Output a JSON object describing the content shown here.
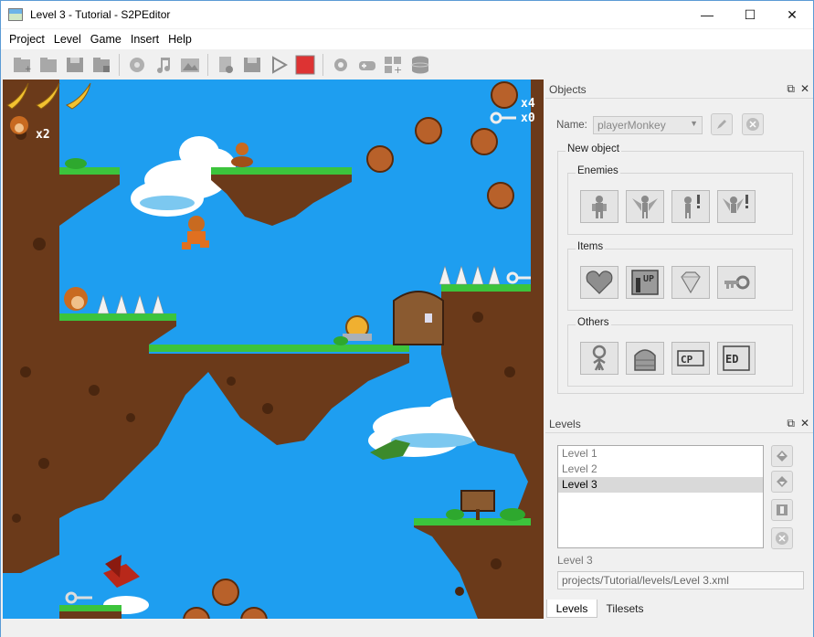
{
  "window": {
    "title": "Level 3 - Tutorial - S2PEditor",
    "minimize_glyph": "—",
    "maximize_glyph": "☐",
    "close_glyph": "✕"
  },
  "menu": {
    "items": [
      "Project",
      "Level",
      "Game",
      "Insert",
      "Help"
    ]
  },
  "toolbar": {
    "icons": [
      "new-project-icon",
      "open-project-icon",
      "save-project-icon",
      "export-project-icon",
      "tileset-icon",
      "music-icon",
      "image-icon",
      "new-level-icon",
      "save-level-icon",
      "play-icon",
      "stop-icon",
      "settings-icon",
      "gamepad-icon",
      "add-tiles-icon",
      "database-icon"
    ]
  },
  "game": {
    "lives": "x2",
    "coins": "x4",
    "keys": "x0"
  },
  "objects_panel": {
    "title": "Objects",
    "name_label": "Name:",
    "name_value": "playerMonkey",
    "new_object_label": "New object",
    "enemies_label": "Enemies",
    "items_label": "Items",
    "others_label": "Others",
    "enemies_icons": [
      "walking-enemy-icon",
      "flying-enemy-icon",
      "alert-enemy-icon",
      "alert-flying-enemy-icon"
    ],
    "items_icons": [
      "heart-icon",
      "one-up-icon",
      "diamond-icon",
      "key-icon"
    ],
    "others_icons": [
      "player-icon",
      "door-icon",
      "checkpoint-icon",
      "end-icon"
    ],
    "others_text": {
      "cp": "CP",
      "end": "ED",
      "one_up": "UP"
    }
  },
  "levels_panel": {
    "title": "Levels",
    "items": [
      "Level 1",
      "Level 2",
      "Level 3"
    ],
    "selected_index": 2,
    "current_label": "Level 3",
    "path": "projects/Tutorial/levels/Level 3.xml",
    "tabs": [
      "Levels",
      "Tilesets"
    ]
  },
  "dock_buttons": {
    "float": "⧉",
    "close": "✕"
  },
  "colors": {
    "sky": "#1e9ef0",
    "ground": "#6b3a1a",
    "grass": "#3cc43c",
    "accent": "#5b9bd5",
    "stop": "#d33"
  }
}
